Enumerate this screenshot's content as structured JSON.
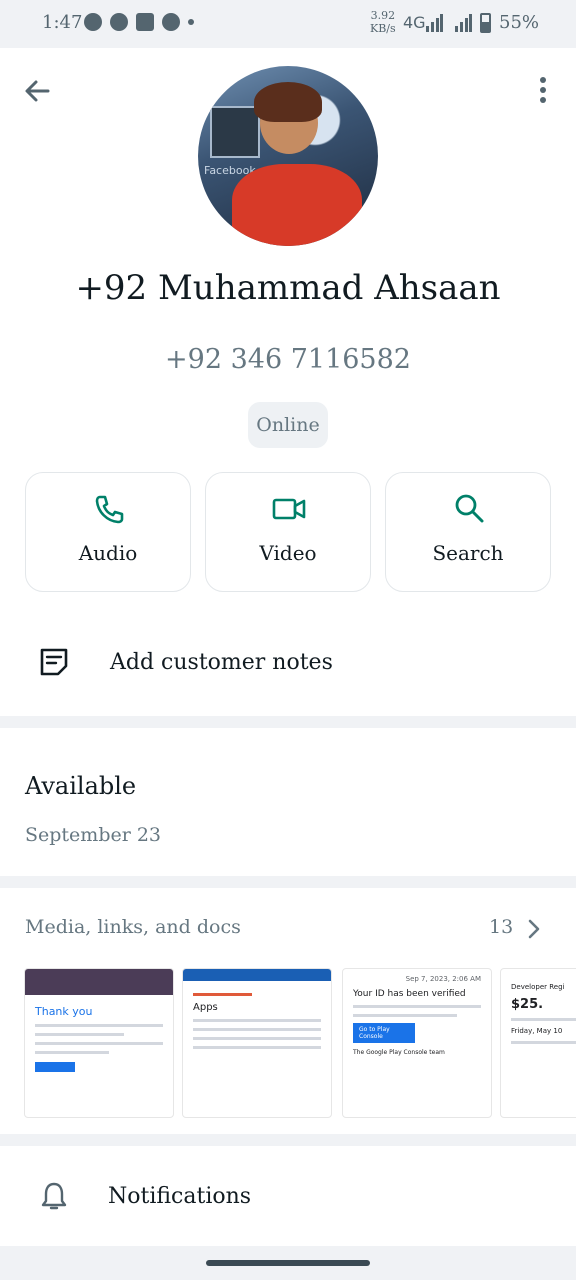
{
  "status_bar": {
    "time": "1:47",
    "speed_value": "3.92",
    "speed_unit": "KB/s",
    "network": "4G",
    "battery": "55%",
    "battery_level": 0.55,
    "notification_icons": [
      "whatsapp-icon",
      "message-icon",
      "facebook-icon",
      "tiktok-icon",
      "dot-icon"
    ]
  },
  "header": {
    "back_icon": "arrow-left-icon",
    "menu_icon": "more-vertical-icon"
  },
  "profile": {
    "avatar_caption": "Facebook",
    "name": "+92 Muhammad Ahsaan",
    "phone": "+92 346 7116582",
    "presence": "Online"
  },
  "actions": [
    {
      "label": "Audio",
      "icon": "phone-icon"
    },
    {
      "label": "Video",
      "icon": "video-icon"
    },
    {
      "label": "Search",
      "icon": "search-icon"
    }
  ],
  "notes": {
    "label": "Add customer notes",
    "icon": "notes-icon"
  },
  "about": {
    "title": "Available",
    "date": "September 23"
  },
  "media": {
    "heading": "Media, links, and docs",
    "count": "13",
    "thumbnails": [
      {
        "title": "Thank you"
      },
      {
        "title": "Apps"
      },
      {
        "title": "Your ID has been verified",
        "button": "Go to Play Console",
        "footer": "The Google Play Console team",
        "date": "Sep 7, 2023, 2:06 AM"
      },
      {
        "title": "Developer Regi",
        "amount": "$25.",
        "date": "Friday, May 10"
      }
    ]
  },
  "notifications": {
    "label": "Notifications",
    "icon": "bell-icon"
  },
  "colors": {
    "accent": "#008069",
    "text": "#111b21",
    "secondary": "#667781",
    "background": "#f0f2f5"
  }
}
